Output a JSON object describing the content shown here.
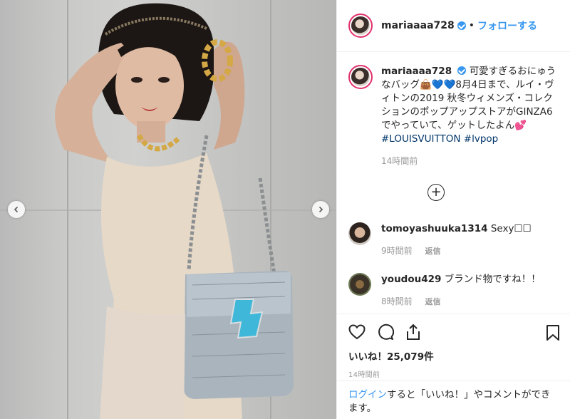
{
  "post": {
    "username": "mariaaaa728",
    "follow_label": "フォローする",
    "caption_text": "可愛すぎるおにゅうなバッグ👜💙💙8月4日まで、ルイ・ヴィトンの2019 秋冬ウィメンズ・コレクションのポップアップストアがGINZA6でやっていて、ゲットしたよん💕",
    "hashtag1": "#LOUISVUITTON",
    "hashtag2": "#lvpop",
    "caption_time": "14時間前",
    "load_more": "+",
    "likes": "いいね！25,079件",
    "post_time": "14時間前"
  },
  "comments": [
    {
      "username": "tomoyashuuka1314",
      "text": "Sexy☐☐",
      "time": "9時間前",
      "reply": "返信"
    },
    {
      "username": "youdou429",
      "text": "ブランド物ですね！！",
      "time": "8時間前",
      "reply": "返信"
    }
  ],
  "login": {
    "link": "ログイン",
    "text": "すると「いいね！」やコメントができます。"
  },
  "colors": {
    "accent": "#3897f0",
    "story_ring": "#e1306c",
    "text": "#262626",
    "muted": "#999999"
  },
  "icons": [
    "heart-icon",
    "comment-icon",
    "share-icon",
    "bookmark-icon",
    "chevron-left-icon",
    "chevron-right-icon",
    "plus-circle-icon",
    "verified-icon"
  ]
}
